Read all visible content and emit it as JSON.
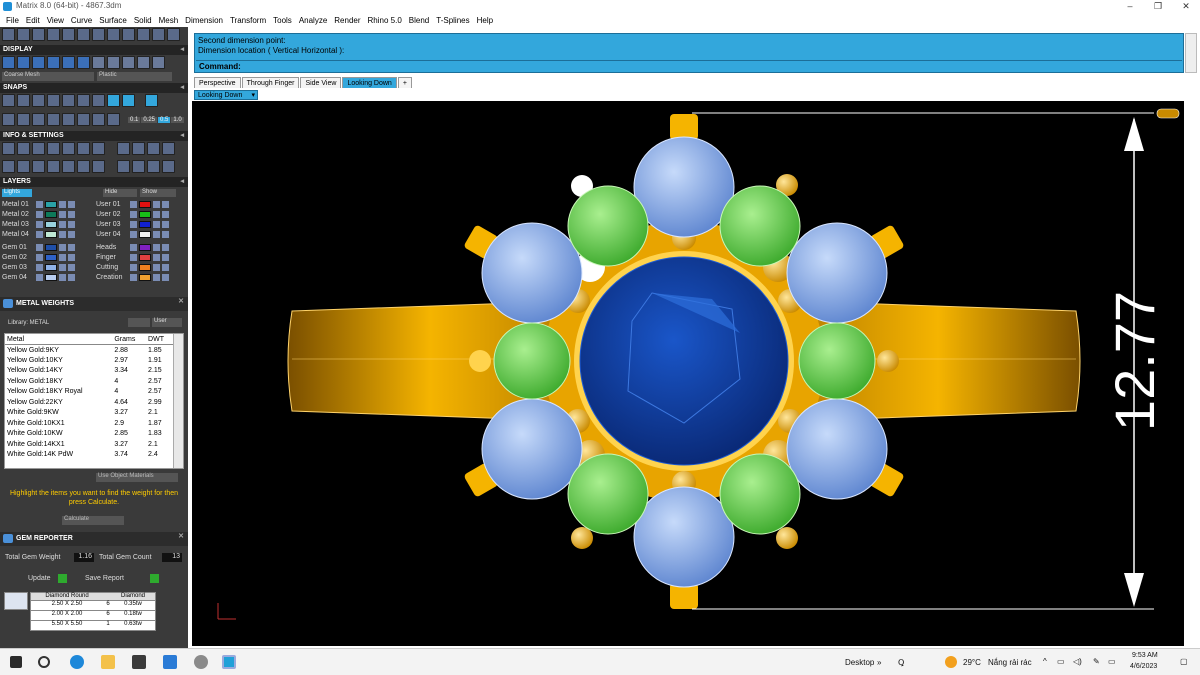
{
  "titlebar": {
    "title": "Matrix 8.0 (64-bit) - 4867.3dm",
    "minimize": "–",
    "maximize": "❐",
    "close": "✕"
  },
  "menu": [
    "File",
    "Edit",
    "View",
    "Curve",
    "Surface",
    "Solid",
    "Mesh",
    "Dimension",
    "Transform",
    "Tools",
    "Analyze",
    "Render",
    "Rhino 5.0",
    "Blend",
    "T-Splines",
    "Help"
  ],
  "panel": {
    "display_title": "DISPLAY",
    "display_mesh": "Coarse Mesh",
    "display_shader": "Plastic",
    "snaps_title": "SNAPS",
    "snap_values": [
      "0.1",
      "0.25",
      "0.5",
      "1.0"
    ],
    "info_title": "INFO & SETTINGS",
    "layers_title": "LAYERS",
    "layers_lights": "Lights",
    "layers_hide": "Hide",
    "layers_show": "Show",
    "layers_left": [
      {
        "name": "Metal 01",
        "color": "#2aa1a6"
      },
      {
        "name": "Metal 02",
        "color": "#0e7a5a"
      },
      {
        "name": "Metal 03",
        "color": "#9ad2de"
      },
      {
        "name": "Metal 04",
        "color": "#bfe8d4"
      },
      {
        "name": "Gem 01",
        "color": "#1f4fa8"
      },
      {
        "name": "Gem 02",
        "color": "#2f62c8"
      },
      {
        "name": "Gem 03",
        "color": "#8fb2e8"
      },
      {
        "name": "Gem 04",
        "color": "#b8cdf0"
      }
    ],
    "layers_right": [
      {
        "name": "User 01",
        "color": "#e01010"
      },
      {
        "name": "User 02",
        "color": "#18c018"
      },
      {
        "name": "User 03",
        "color": "#1020d0"
      },
      {
        "name": "User 04",
        "color": "#f0f0f0"
      },
      {
        "name": "Heads",
        "color": "#8020c0"
      },
      {
        "name": "Finger",
        "color": "#e04040"
      },
      {
        "name": "Cutting",
        "color": "#f08020"
      },
      {
        "name": "Creation",
        "color": "#f0a030"
      }
    ],
    "mw_title": "METAL WEIGHTS",
    "mw_library_label": "Library: METAL",
    "mw_btn_user": "User",
    "mw_headers": [
      "Metal",
      "Grams",
      "DWT"
    ],
    "mw_rows": [
      [
        "Yellow Gold:9KY",
        "2.88",
        "1.85"
      ],
      [
        "Yellow Gold:10KY",
        "2.97",
        "1.91"
      ],
      [
        "Yellow Gold:14KY",
        "3.34",
        "2.15"
      ],
      [
        "Yellow Gold:18KY",
        "4",
        "2.57"
      ],
      [
        "Yellow Gold:18KY Royal",
        "4",
        "2.57"
      ],
      [
        "Yellow Gold:22KY",
        "4.64",
        "2.99"
      ],
      [
        "White Gold:9KW",
        "3.27",
        "2.1"
      ],
      [
        "White Gold:10KX1",
        "2.9",
        "1.87"
      ],
      [
        "White Gold:10KW",
        "2.85",
        "1.83"
      ],
      [
        "White Gold:14KX1",
        "3.27",
        "2.1"
      ],
      [
        "White Gold:14K PdW",
        "3.74",
        "2.4"
      ]
    ],
    "mw_use_object": "Use Object Materials",
    "mw_hint": "Highlight the items you want to find the weight for then press Calculate.",
    "mw_calculate": "Calculate",
    "gem_title": "GEM REPORTER",
    "total_gem_weight_label": "Total Gem Weight",
    "total_gem_weight": "1.16",
    "total_gem_count_label": "Total Gem Count",
    "total_gem_count": "13",
    "update": "Update",
    "save_report": "Save Report",
    "gem_headers": [
      "Diamond Round",
      "",
      "Diamond"
    ],
    "gem_rows": [
      [
        "2.50 X 2.50",
        "6",
        "0.35tw"
      ],
      [
        "2.00 X 2.00",
        "6",
        "0.18tw"
      ],
      [
        "5.50 X 5.50",
        "1",
        "0.63tw"
      ]
    ]
  },
  "command": {
    "line1": "Second dimension point:",
    "line2": "Dimension location ( Vertical  Horizontal ):",
    "prompt": "Command:"
  },
  "tabs": [
    "Perspective",
    "Through Finger",
    "Side View",
    "Looking Down",
    "+"
  ],
  "active_tab": "Looking Down",
  "viewport_label": "Looking Down",
  "dimension_value": "12.77",
  "taskbar": {
    "desktop": "Desktop",
    "weather_temp": "29°C",
    "weather_text": "Nắng rải rác",
    "time": "9:53 AM",
    "date": "4/6/2023"
  },
  "colors": {
    "accent": "#33a7dc",
    "gold": "#f5b400",
    "sapphire": "#0f3a9c",
    "green_gem": "#4fbf3a",
    "light_blue_gem": "#6d95dc"
  }
}
